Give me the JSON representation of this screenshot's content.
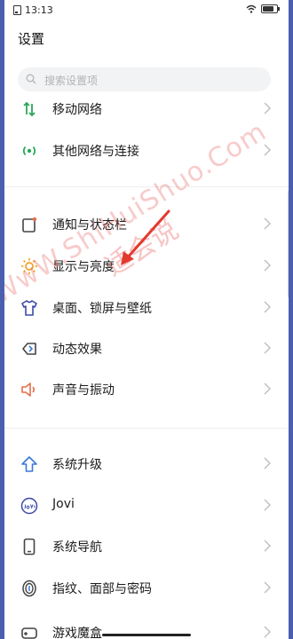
{
  "status": {
    "time": "13:13"
  },
  "page": {
    "title": "设置"
  },
  "search": {
    "placeholder": "搜索设置项"
  },
  "items": [
    {
      "label": "移动网络",
      "icon": "mobile-network-icon"
    },
    {
      "label": "其他网络与连接",
      "icon": "other-network-icon"
    },
    {
      "label": "通知与状态栏",
      "icon": "notification-icon"
    },
    {
      "label": "显示与亮度",
      "icon": "brightness-icon"
    },
    {
      "label": "桌面、锁屏与壁纸",
      "icon": "wallpaper-icon"
    },
    {
      "label": "动态效果",
      "icon": "dynamic-effect-icon"
    },
    {
      "label": "声音与振动",
      "icon": "sound-icon"
    },
    {
      "label": "系统升级",
      "icon": "system-upgrade-icon"
    },
    {
      "label": "Jovi",
      "icon": "jovi-icon"
    },
    {
      "label": "系统导航",
      "icon": "system-navigation-icon"
    },
    {
      "label": "指纹、面部与密码",
      "icon": "fingerprint-icon"
    },
    {
      "label": "游戏魔盒",
      "icon": "game-box-icon"
    }
  ],
  "watermark": {
    "text": "WwW.ShiHuiShuo.Com",
    "cn": "适会说"
  },
  "colors": {
    "network": "#2aa85a",
    "brightness": "#f0a020",
    "sound": "#e5704a",
    "primary": "#3a78d8",
    "watermark": "#e64646"
  }
}
